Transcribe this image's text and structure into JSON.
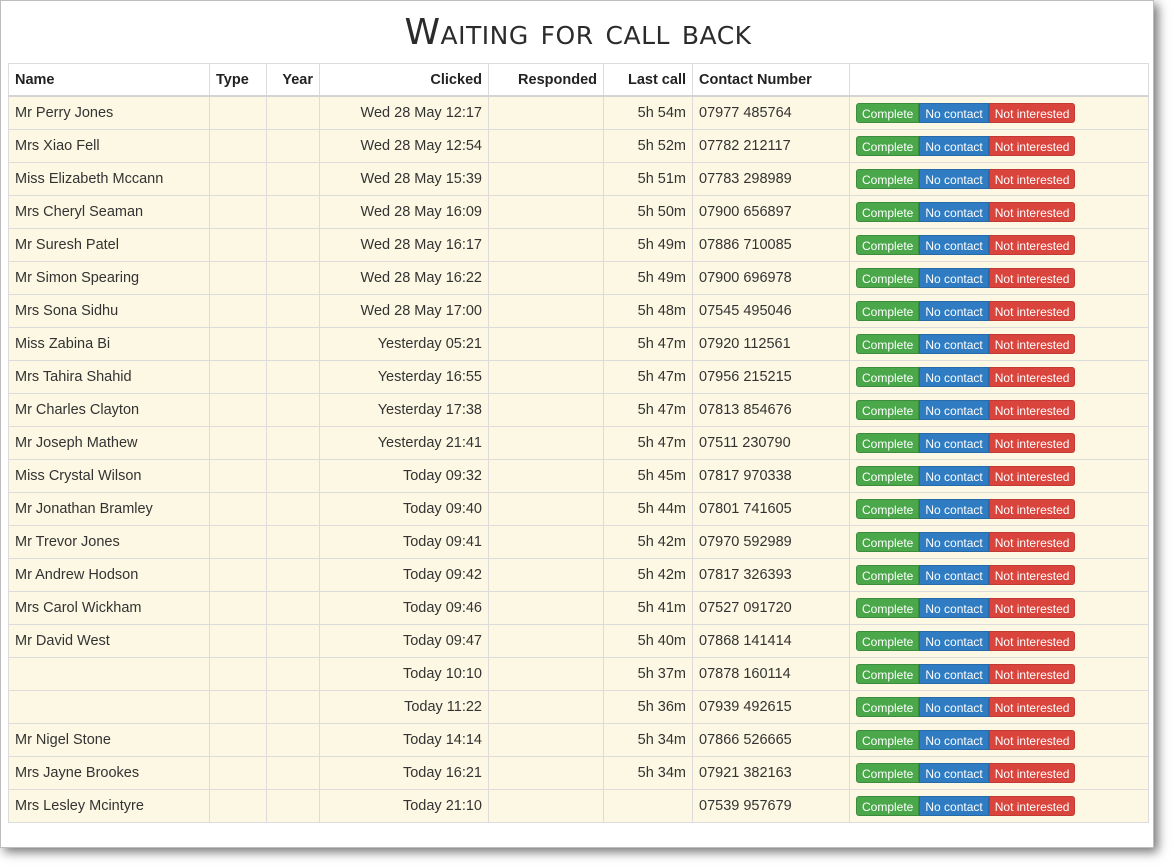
{
  "page": {
    "title": "Waiting for call back"
  },
  "table": {
    "headers": {
      "name": "Name",
      "type": "Type",
      "year": "Year",
      "clicked": "Clicked",
      "responded": "Responded",
      "last_call": "Last call",
      "contact": "Contact Number",
      "actions": ""
    },
    "buttons": {
      "complete": "Complete",
      "no_contact": "No contact",
      "not_interested": "Not interested"
    },
    "rows": [
      {
        "name": "Mr Perry Jones",
        "type": "",
        "year": "",
        "clicked": "Wed 28 May 12:17",
        "responded": "",
        "last_call": "5h 54m",
        "contact": "07977 485764"
      },
      {
        "name": "Mrs Xiao Fell",
        "type": "",
        "year": "",
        "clicked": "Wed 28 May 12:54",
        "responded": "",
        "last_call": "5h 52m",
        "contact": "07782 212117"
      },
      {
        "name": "Miss Elizabeth Mccann",
        "type": "",
        "year": "",
        "clicked": "Wed 28 May 15:39",
        "responded": "",
        "last_call": "5h 51m",
        "contact": "07783 298989"
      },
      {
        "name": "Mrs Cheryl Seaman",
        "type": "",
        "year": "",
        "clicked": "Wed 28 May 16:09",
        "responded": "",
        "last_call": "5h 50m",
        "contact": "07900 656897"
      },
      {
        "name": "Mr Suresh Patel",
        "type": "",
        "year": "",
        "clicked": "Wed 28 May 16:17",
        "responded": "",
        "last_call": "5h 49m",
        "contact": "07886 710085"
      },
      {
        "name": "Mr Simon Spearing",
        "type": "",
        "year": "",
        "clicked": "Wed 28 May 16:22",
        "responded": "",
        "last_call": "5h 49m",
        "contact": "07900 696978"
      },
      {
        "name": "Mrs Sona Sidhu",
        "type": "",
        "year": "",
        "clicked": "Wed 28 May 17:00",
        "responded": "",
        "last_call": "5h 48m",
        "contact": "07545 495046"
      },
      {
        "name": "Miss Zabina Bi",
        "type": "",
        "year": "",
        "clicked": "Yesterday 05:21",
        "responded": "",
        "last_call": "5h 47m",
        "contact": "07920 112561"
      },
      {
        "name": "Mrs Tahira Shahid",
        "type": "",
        "year": "",
        "clicked": "Yesterday 16:55",
        "responded": "",
        "last_call": "5h 47m",
        "contact": "07956 215215"
      },
      {
        "name": "Mr Charles Clayton",
        "type": "",
        "year": "",
        "clicked": "Yesterday 17:38",
        "responded": "",
        "last_call": "5h 47m",
        "contact": "07813 854676"
      },
      {
        "name": "Mr Joseph Mathew",
        "type": "",
        "year": "",
        "clicked": "Yesterday 21:41",
        "responded": "",
        "last_call": "5h 47m",
        "contact": "07511 230790"
      },
      {
        "name": "Miss Crystal Wilson",
        "type": "",
        "year": "",
        "clicked": "Today 09:32",
        "responded": "",
        "last_call": "5h 45m",
        "contact": "07817 970338"
      },
      {
        "name": "Mr Jonathan Bramley",
        "type": "",
        "year": "",
        "clicked": "Today 09:40",
        "responded": "",
        "last_call": "5h 44m",
        "contact": "07801 741605"
      },
      {
        "name": "Mr Trevor Jones",
        "type": "",
        "year": "",
        "clicked": "Today 09:41",
        "responded": "",
        "last_call": "5h 42m",
        "contact": "07970 592989"
      },
      {
        "name": "Mr Andrew Hodson",
        "type": "",
        "year": "",
        "clicked": "Today 09:42",
        "responded": "",
        "last_call": "5h 42m",
        "contact": "07817 326393"
      },
      {
        "name": "Mrs Carol Wickham",
        "type": "",
        "year": "",
        "clicked": "Today 09:46",
        "responded": "",
        "last_call": "5h 41m",
        "contact": "07527 091720"
      },
      {
        "name": "Mr David West",
        "type": "",
        "year": "",
        "clicked": "Today 09:47",
        "responded": "",
        "last_call": "5h 40m",
        "contact": "07868 141414"
      },
      {
        "name": "",
        "type": "",
        "year": "",
        "clicked": "Today 10:10",
        "responded": "",
        "last_call": "5h 37m",
        "contact": "07878 160114"
      },
      {
        "name": "",
        "type": "",
        "year": "",
        "clicked": "Today 11:22",
        "responded": "",
        "last_call": "5h 36m",
        "contact": "07939 492615"
      },
      {
        "name": "Mr Nigel Stone",
        "type": "",
        "year": "",
        "clicked": "Today 14:14",
        "responded": "",
        "last_call": "5h 34m",
        "contact": "07866 526665"
      },
      {
        "name": "Mrs Jayne Brookes",
        "type": "",
        "year": "",
        "clicked": "Today 16:21",
        "responded": "",
        "last_call": "5h 34m",
        "contact": "07921 382163"
      },
      {
        "name": "Mrs Lesley Mcintyre",
        "type": "",
        "year": "",
        "clicked": "Today 21:10",
        "responded": "",
        "last_call": "",
        "contact": "07539 957679"
      }
    ]
  },
  "colors": {
    "row_bg": "#fcf8e3",
    "complete": "#4aa84a",
    "no_contact": "#2f7cc2",
    "not_interested": "#d9453d"
  }
}
